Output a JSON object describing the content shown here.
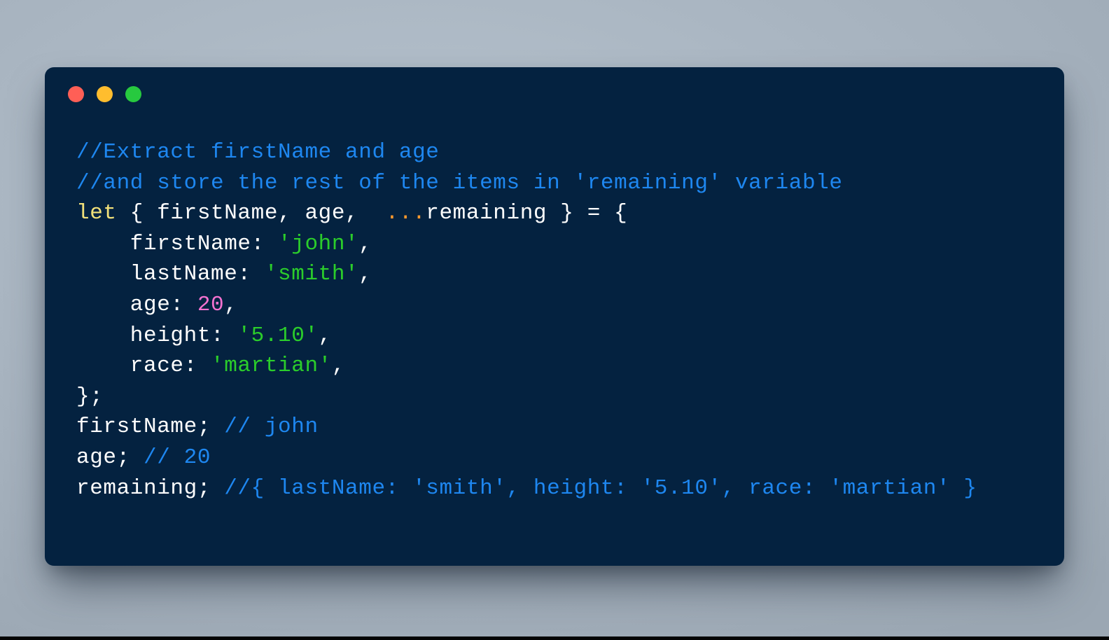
{
  "window": {
    "name": "code-snippet-window",
    "background_color": "#a9b5c1",
    "card_color": "#042240",
    "traffic_lights": [
      {
        "name": "close",
        "color": "#ff5f56"
      },
      {
        "name": "minimize",
        "color": "#ffbd2e"
      },
      {
        "name": "maximize",
        "color": "#27c93f"
      }
    ]
  },
  "syntax_colors": {
    "comment": "#1e87f0",
    "keyword": "#f2e17a",
    "string": "#2bcd2b",
    "number": "#f472d0",
    "spread": "#ff9a2e",
    "plain": "#fdfdfd"
  },
  "code": {
    "language": "javascript",
    "full_text": "//Extract firstName and age\n//and store the rest of the items in 'remaining' variable\nlet { firstName, age,  ...remaining } = {\n    firstName: 'john',\n    lastName: 'smith',\n    age: 20,\n    height: '5.10',\n    race: 'martian',\n};\nfirstName; // john\nage; // 20\nremaining; //{ lastName: 'smith', height: '5.10', race: 'martian' }",
    "lines": [
      {
        "n": 1,
        "tokens": [
          {
            "t": "//Extract firstName and age",
            "c": "comment"
          }
        ]
      },
      {
        "n": 2,
        "tokens": [
          {
            "t": "//and store the rest of the items in 'remaining' variable",
            "c": "comment"
          }
        ]
      },
      {
        "n": 3,
        "tokens": [
          {
            "t": "let",
            "c": "keyword"
          },
          {
            "t": " { firstName, age,  ",
            "c": "plain"
          },
          {
            "t": "...",
            "c": "spread"
          },
          {
            "t": "remaining } = {",
            "c": "plain"
          }
        ]
      },
      {
        "n": 4,
        "tokens": [
          {
            "t": "    firstName: ",
            "c": "plain"
          },
          {
            "t": "'john'",
            "c": "string"
          },
          {
            "t": ",",
            "c": "plain"
          }
        ]
      },
      {
        "n": 5,
        "tokens": [
          {
            "t": "    lastName: ",
            "c": "plain"
          },
          {
            "t": "'smith'",
            "c": "string"
          },
          {
            "t": ",",
            "c": "plain"
          }
        ]
      },
      {
        "n": 6,
        "tokens": [
          {
            "t": "    age: ",
            "c": "plain"
          },
          {
            "t": "20",
            "c": "number"
          },
          {
            "t": ",",
            "c": "plain"
          }
        ]
      },
      {
        "n": 7,
        "tokens": [
          {
            "t": "    height: ",
            "c": "plain"
          },
          {
            "t": "'5.10'",
            "c": "string"
          },
          {
            "t": ",",
            "c": "plain"
          }
        ]
      },
      {
        "n": 8,
        "tokens": [
          {
            "t": "    race: ",
            "c": "plain"
          },
          {
            "t": "'martian'",
            "c": "string"
          },
          {
            "t": ",",
            "c": "plain"
          }
        ]
      },
      {
        "n": 9,
        "tokens": [
          {
            "t": "};",
            "c": "plain"
          }
        ]
      },
      {
        "n": 10,
        "tokens": [
          {
            "t": "firstName; ",
            "c": "plain"
          },
          {
            "t": "// john",
            "c": "comment"
          }
        ]
      },
      {
        "n": 11,
        "tokens": [
          {
            "t": "age; ",
            "c": "plain"
          },
          {
            "t": "// 20",
            "c": "comment"
          }
        ]
      },
      {
        "n": 12,
        "tokens": [
          {
            "t": "remaining; ",
            "c": "plain"
          },
          {
            "t": "//{ lastName: 'smith', height: '5.10', race: 'martian' }",
            "c": "comment"
          }
        ]
      }
    ]
  }
}
